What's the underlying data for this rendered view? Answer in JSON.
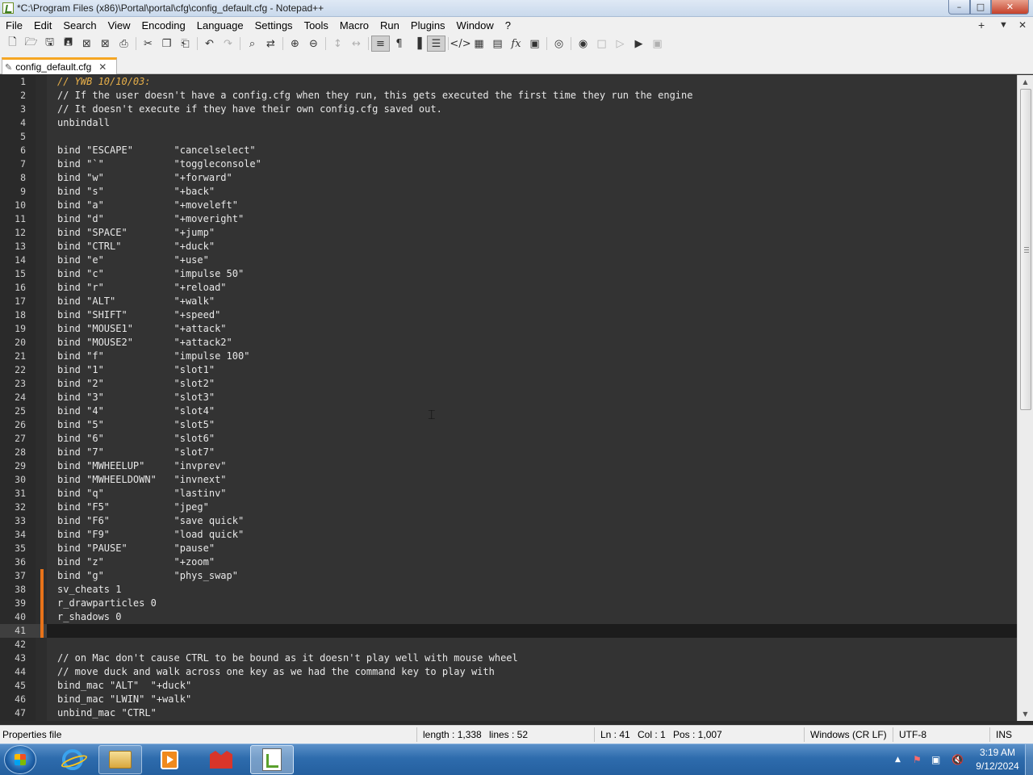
{
  "window": {
    "title": "*C:\\Program Files (x86)\\Portal\\portal\\cfg\\config_default.cfg - Notepad++",
    "min_glyph": "–",
    "max_glyph": "□",
    "close_glyph": "✕"
  },
  "menu": {
    "items": [
      "File",
      "Edit",
      "Search",
      "View",
      "Encoding",
      "Language",
      "Settings",
      "Tools",
      "Macro",
      "Run",
      "Plugins",
      "Window",
      "?"
    ],
    "right_controls": [
      "+",
      "▼",
      "✕"
    ]
  },
  "toolbar": {
    "icons": [
      "new-file-icon",
      "open-file-icon",
      "save-icon",
      "save-all-icon",
      "close-icon",
      "close-all-icon",
      "print-icon",
      "cut-icon",
      "copy-icon",
      "paste-icon",
      "undo-icon",
      "redo-icon",
      "find-icon",
      "replace-icon",
      "zoom-in-icon",
      "zoom-out-icon",
      "sync-vertical-icon",
      "sync-horizontal-icon",
      "word-wrap-icon",
      "show-all-chars-icon",
      "indent-guide-icon",
      "document-map-icon",
      "xml-tag-icon",
      "map-icon",
      "doc-list-icon",
      "function-list-icon",
      "folder-as-workspace-icon",
      "monitoring-icon",
      "record-macro-icon",
      "stop-macro-icon",
      "play-macro-icon",
      "run-macro-multiple-icon",
      "save-macro-icon"
    ]
  },
  "tab": {
    "label": "config_default.cfg",
    "icon": "✎",
    "close": "✕"
  },
  "editor": {
    "current_line": 41,
    "changed_lines": [
      37,
      38,
      39,
      40,
      41
    ],
    "lines": [
      {
        "n": "1",
        "text": "// YWB 10/10/03:"
      },
      {
        "n": "2",
        "text": "// If the user doesn't have a config.cfg when they run, this gets executed the first time they run the engine"
      },
      {
        "n": "3",
        "text": "// It doesn't execute if they have their own config.cfg saved out."
      },
      {
        "n": "4",
        "text": "unbindall"
      },
      {
        "n": "5",
        "text": ""
      },
      {
        "n": "6",
        "text": "bind \"ESCAPE\"       \"cancelselect\""
      },
      {
        "n": "7",
        "text": "bind \"`\"            \"toggleconsole\""
      },
      {
        "n": "8",
        "text": "bind \"w\"            \"+forward\""
      },
      {
        "n": "9",
        "text": "bind \"s\"            \"+back\""
      },
      {
        "n": "10",
        "text": "bind \"a\"            \"+moveleft\""
      },
      {
        "n": "11",
        "text": "bind \"d\"            \"+moveright\""
      },
      {
        "n": "12",
        "text": "bind \"SPACE\"        \"+jump\""
      },
      {
        "n": "13",
        "text": "bind \"CTRL\"         \"+duck\""
      },
      {
        "n": "14",
        "text": "bind \"e\"            \"+use\""
      },
      {
        "n": "15",
        "text": "bind \"c\"            \"impulse 50\""
      },
      {
        "n": "16",
        "text": "bind \"r\"            \"+reload\""
      },
      {
        "n": "17",
        "text": "bind \"ALT\"          \"+walk\""
      },
      {
        "n": "18",
        "text": "bind \"SHIFT\"        \"+speed\""
      },
      {
        "n": "19",
        "text": "bind \"MOUSE1\"       \"+attack\""
      },
      {
        "n": "20",
        "text": "bind \"MOUSE2\"       \"+attack2\""
      },
      {
        "n": "21",
        "text": "bind \"f\"            \"impulse 100\""
      },
      {
        "n": "22",
        "text": "bind \"1\"            \"slot1\""
      },
      {
        "n": "23",
        "text": "bind \"2\"            \"slot2\""
      },
      {
        "n": "24",
        "text": "bind \"3\"            \"slot3\""
      },
      {
        "n": "25",
        "text": "bind \"4\"            \"slot4\""
      },
      {
        "n": "26",
        "text": "bind \"5\"            \"slot5\""
      },
      {
        "n": "27",
        "text": "bind \"6\"            \"slot6\""
      },
      {
        "n": "28",
        "text": "bind \"7\"            \"slot7\""
      },
      {
        "n": "29",
        "text": "bind \"MWHEELUP\"     \"invprev\""
      },
      {
        "n": "30",
        "text": "bind \"MWHEELDOWN\"   \"invnext\""
      },
      {
        "n": "31",
        "text": "bind \"q\"            \"lastinv\""
      },
      {
        "n": "32",
        "text": "bind \"F5\"           \"jpeg\""
      },
      {
        "n": "33",
        "text": "bind \"F6\"           \"save quick\""
      },
      {
        "n": "34",
        "text": "bind \"F9\"           \"load quick\""
      },
      {
        "n": "35",
        "text": "bind \"PAUSE\"        \"pause\""
      },
      {
        "n": "36",
        "text": "bind \"z\"            \"+zoom\""
      },
      {
        "n": "37",
        "text": "bind \"g\"            \"phys_swap\""
      },
      {
        "n": "38",
        "text": "sv_cheats 1"
      },
      {
        "n": "39",
        "text": "r_drawparticles 0"
      },
      {
        "n": "40",
        "text": "r_shadows 0"
      },
      {
        "n": "41",
        "text": ""
      },
      {
        "n": "42",
        "text": ""
      },
      {
        "n": "43",
        "text": "// on Mac don't cause CTRL to be bound as it doesn't play well with mouse wheel"
      },
      {
        "n": "44",
        "text": "// move duck and walk across one key as we had the command key to play with"
      },
      {
        "n": "45",
        "text": "bind_mac \"ALT\"  \"+duck\""
      },
      {
        "n": "46",
        "text": "bind_mac \"LWIN\" \"+walk\""
      },
      {
        "n": "47",
        "text": "unbind_mac \"CTRL\""
      }
    ]
  },
  "status": {
    "file_type": "Properties file",
    "length": "length : 1,338",
    "lines": "lines : 52",
    "ln": "Ln : 41",
    "col": "Col : 1",
    "pos": "Pos : 1,007",
    "eol": "Windows (CR LF)",
    "encoding": "UTF-8",
    "mode": "INS"
  },
  "taskbar": {
    "apps": [
      "internet-explorer",
      "windows-explorer",
      "media-player",
      "gift-app",
      "notepad-plus-plus"
    ],
    "clock_time": "3:19 AM",
    "clock_date": "9/12/2024"
  }
}
